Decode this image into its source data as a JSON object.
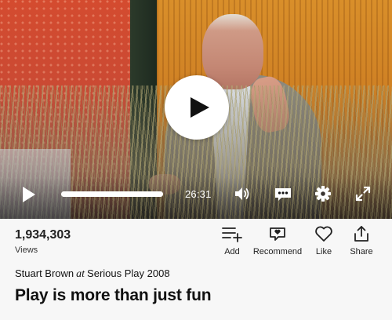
{
  "player": {
    "elapsed_fraction": 1.0,
    "duration": "26:31"
  },
  "stats": {
    "views_count": "1,934,303",
    "views_label": "Views"
  },
  "actions": {
    "add_label": "Add",
    "recommend_label": "Recommend",
    "like_label": "Like",
    "share_label": "Share"
  },
  "talk": {
    "speaker": "Stuart Brown",
    "at": "at",
    "event": "Serious Play 2008",
    "title": "Play is more than just fun"
  },
  "icons": {
    "play": "play-icon",
    "volume": "volume-icon",
    "captions": "captions-icon",
    "settings": "gear-icon",
    "fullscreen": "fullscreen-icon",
    "add": "playlist-add-icon",
    "recommend": "recommend-icon",
    "like": "heart-icon",
    "share": "share-icon"
  }
}
